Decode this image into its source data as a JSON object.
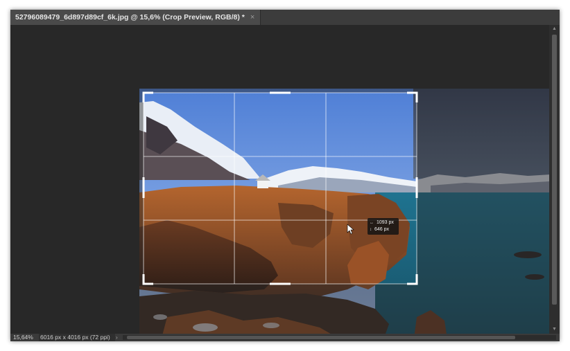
{
  "tab": {
    "title": "52796089479_6d897d89cf_6k.jpg @ 15,6% (Crop Preview, RGB/8) *",
    "close_glyph": "×"
  },
  "status": {
    "zoom": "15,64%",
    "document_size": "6016 px x 4016 px (72 ppi)",
    "arrow_glyph": "›"
  },
  "crop_readout": {
    "width": "1093 px",
    "height": "646 px",
    "width_icon": "width-icon",
    "height_icon": "height-icon"
  },
  "colors": {
    "window_bg": "#282828",
    "tab_active": "#4a4a4a",
    "crop_handle": "#ffffff",
    "sea": "#1e6f88",
    "rock": "#a3582a"
  }
}
